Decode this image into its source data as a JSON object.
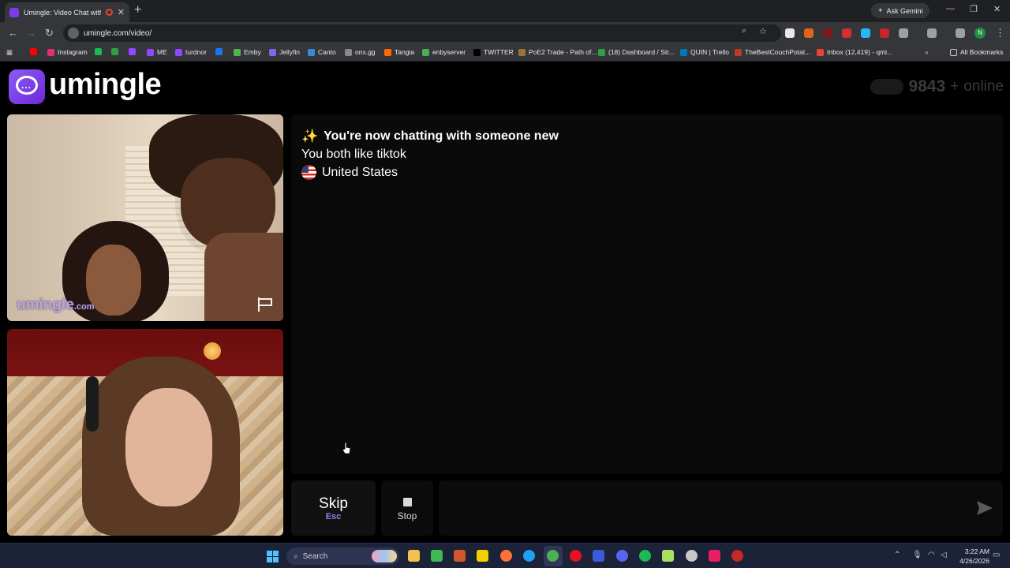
{
  "browser": {
    "tab_title": "Umingle: Video Chat with S",
    "new_tab": "+",
    "ask_gemini": "Ask Gemini",
    "url": "umingle.com/video/",
    "all_bookmarks": "All Bookmarks",
    "bookmarks": [
      {
        "label": "",
        "color": "#ff0000"
      },
      {
        "label": "Instagram",
        "color": "#e1306c"
      },
      {
        "label": "",
        "color": "#1db954"
      },
      {
        "label": "",
        "color": "#2ea043"
      },
      {
        "label": "",
        "color": "#9146ff"
      },
      {
        "label": "ME",
        "color": "#9146ff"
      },
      {
        "label": "turdnor",
        "color": "#9146ff"
      },
      {
        "label": "",
        "color": "#1877f2"
      },
      {
        "label": "Emby",
        "color": "#52b54b"
      },
      {
        "label": "Jellyfin",
        "color": "#7b68ee"
      },
      {
        "label": "Canto",
        "color": "#3a8bd6"
      },
      {
        "label": "onx.gg",
        "color": "#888888"
      },
      {
        "label": "Tangia",
        "color": "#ff6a00"
      },
      {
        "label": "enbyserver",
        "color": "#4caf50"
      },
      {
        "label": "TWITTER",
        "color": "#000000"
      },
      {
        "label": "PoE2 Trade - Path of...",
        "color": "#a0703a"
      },
      {
        "label": "(18) Dashboard / Str...",
        "color": "#2ea043"
      },
      {
        "label": "QUIN | Trello",
        "color": "#0079bf"
      },
      {
        "label": "TheBestCouchPotat...",
        "color": "#c0392b"
      },
      {
        "label": "Inbox (12,419) - qmi...",
        "color": "#ea4335"
      }
    ]
  },
  "site": {
    "logo_text": "umingle",
    "online_count": "9843",
    "online_plus": "+",
    "online_label": "online"
  },
  "stranger_video": {
    "watermark": "umingle",
    "watermark_suffix": ".com"
  },
  "chat": {
    "sparkle": "✨",
    "headline": "You're now chatting with someone new",
    "common_interest": "You both like tiktok",
    "country": "United States"
  },
  "controls": {
    "skip_label": "Skip",
    "skip_hotkey": "Esc",
    "stop_label": "Stop",
    "message_placeholder": ""
  },
  "taskbar": {
    "search_label": "Search",
    "time": "3:22 AM",
    "date": "4/26/2026"
  },
  "colors": {
    "accent": "#8b5cf6",
    "page_bg": "#000000",
    "panel_bg": "#0a0a0a"
  }
}
